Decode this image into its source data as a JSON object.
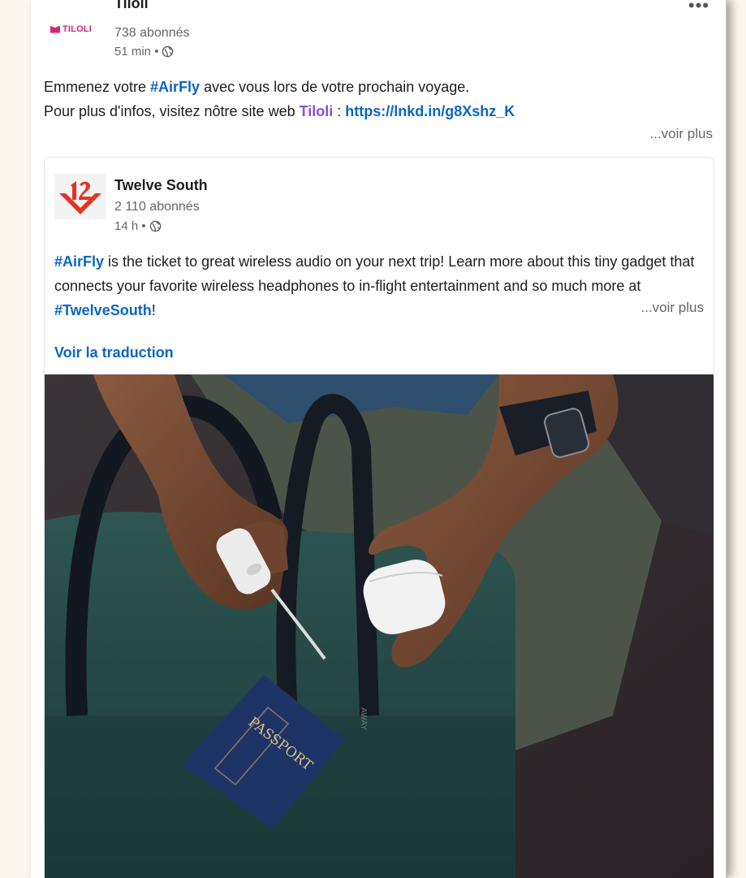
{
  "post": {
    "more_menu": "•••",
    "author": {
      "name": "Tiloli",
      "logo_text": "TILOLI",
      "followers": "738 abonnés",
      "time": "51 min •"
    },
    "text": {
      "line1_prefix": "Emmenez votre ",
      "hashtag_airfly": "#AirFly",
      "line1_suffix": " avec vous lors de votre prochain voyage.",
      "line2_prefix": "Pour plus d'infos, visitez nôtre site web ",
      "mention_tiloli": "Tiloli",
      "line2_separator": " : ",
      "link": "https://lnkd.in/g8Xshz_K"
    },
    "see_more": "...voir plus"
  },
  "shared_post": {
    "author": {
      "name": "Twelve South",
      "followers": "2 110 abonnés",
      "time": "14 h •"
    },
    "text": {
      "hashtag_airfly": "#AirFly",
      "body": " is the ticket to great wireless audio on your next trip! Learn more about this tiny gadget that connects your favorite wireless headphones to in-flight entertainment and so much more at ",
      "hashtag_twelvesouth": "#TwelveSouth",
      "end": "!"
    },
    "see_more": "...voir plus",
    "translate": "Voir la traduction",
    "image": {
      "passport_text": "PASSPORT",
      "bag_label": "AWAY"
    }
  },
  "colors": {
    "hashtag": "#0a66c2",
    "mention": "#8a4fd6",
    "tiloli_brand": "#d6247a",
    "twelve_south_brand": "#e63324"
  }
}
